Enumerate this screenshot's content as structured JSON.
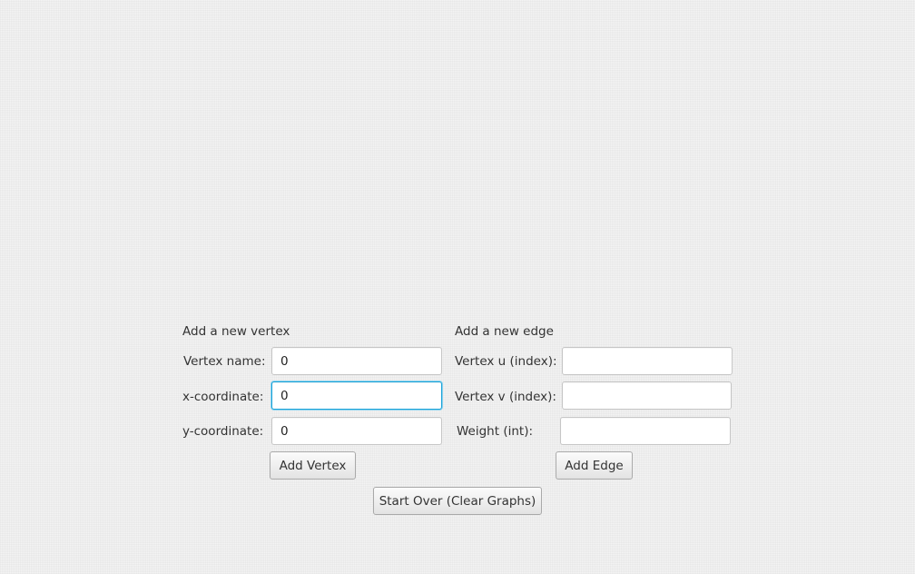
{
  "vertex_section": {
    "heading": "Add a new vertex",
    "name_label": "Vertex name:",
    "name_value": "0",
    "x_label": "x-coordinate:",
    "x_value": "0",
    "y_label": "y-coordinate:",
    "y_value": "0",
    "add_button": "Add Vertex"
  },
  "edge_section": {
    "heading": "Add a new edge",
    "u_label": "Vertex u (index):",
    "u_value": "",
    "v_label": "Vertex v (index):",
    "v_value": "",
    "weight_label": "Weight (int):",
    "weight_value": "",
    "add_button": "Add Edge"
  },
  "start_over_button": "Start Over (Clear Graphs)"
}
